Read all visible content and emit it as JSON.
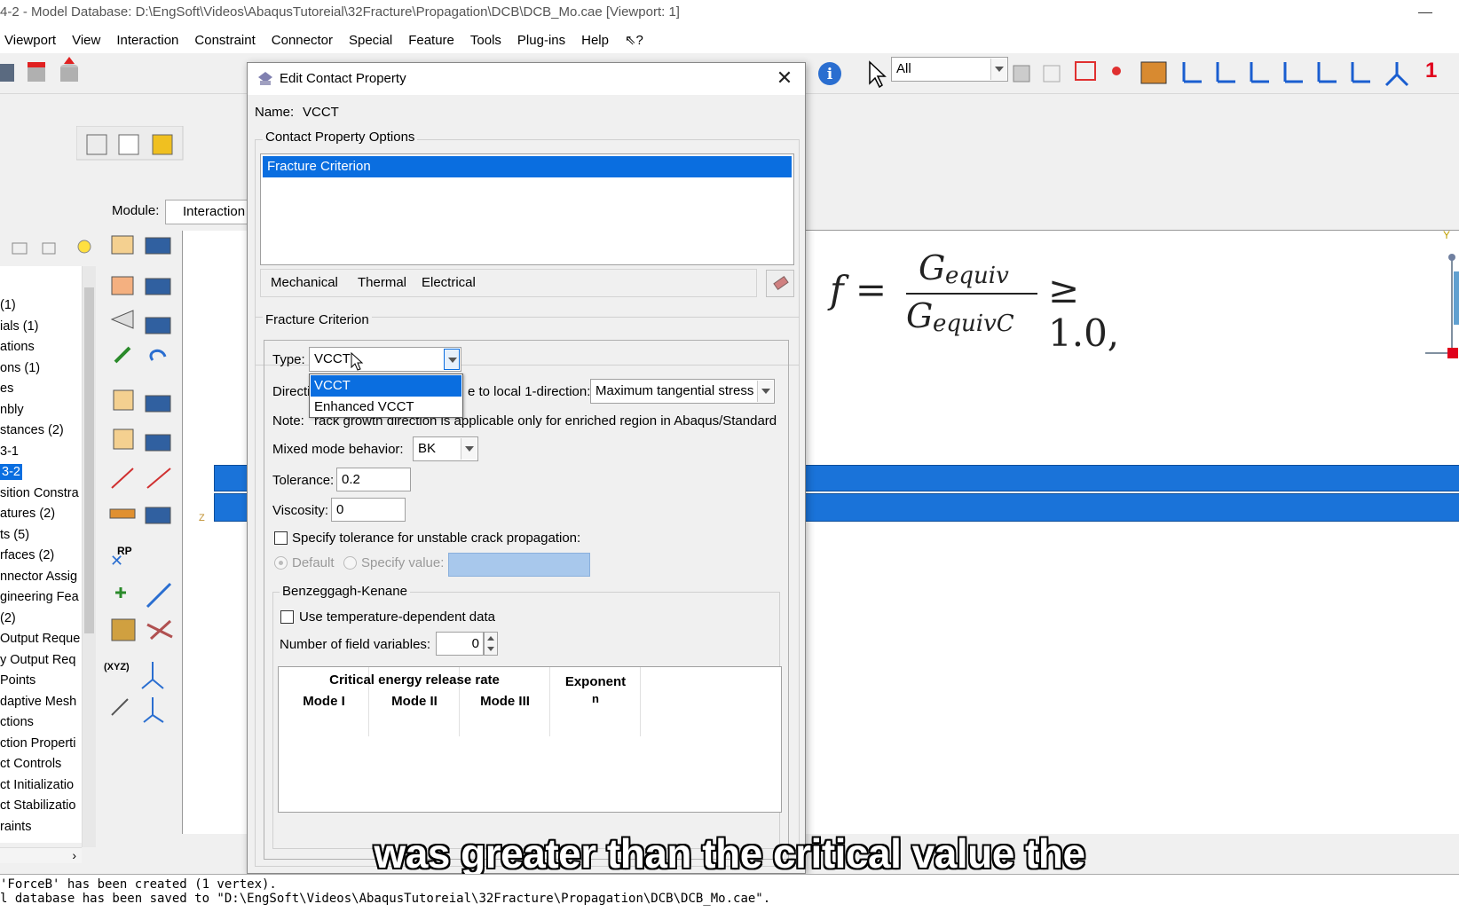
{
  "window": {
    "title": "4-2 - Model Database: D:\\EngSoft\\Videos\\AbaqusTutoreial\\32Fracture\\Propagation\\DCB\\DCB_Mo.cae [Viewport: 1]"
  },
  "menubar": {
    "items": [
      "Viewport",
      "View",
      "Interaction",
      "Constraint",
      "Connector",
      "Special",
      "Feature",
      "Tools",
      "Plug-ins",
      "Help",
      "⇖?"
    ]
  },
  "toolbar": {
    "selection_filter": "All",
    "triad_number": "1"
  },
  "module": {
    "label": "Module:",
    "value": "Interaction"
  },
  "tree": {
    "items": [
      "(1)",
      "ials (1)",
      "ations",
      "ons (1)",
      "es",
      "nbly",
      "stances (2)",
      "3-1",
      "3-2",
      "sition Constra",
      "atures (2)",
      "ts (5)",
      "rfaces (2)",
      "nnector Assig",
      "gineering Fea",
      " (2)",
      "Output Reque",
      "y Output Req",
      "Points",
      "daptive Mesh",
      "ctions",
      "ction Properti",
      "ct Controls",
      "ct Initializatio",
      "ct Stabilizatio",
      "raints"
    ],
    "selected_index": 8
  },
  "palette": {
    "rp_label": "RP",
    "xyz_label": "(XYZ)"
  },
  "formula": {
    "lhs": "f =",
    "numerator": "G",
    "numerator_sub": "equiv",
    "denominator": "G",
    "denominator_sub": "equivC",
    "rhs": "≥ 1.0,"
  },
  "canvas": {
    "axis_y": "Y",
    "axis_z": "Z"
  },
  "dialog": {
    "title": "Edit Contact Property",
    "name_label": "Name:",
    "name_value": "VCCT",
    "options_title": "Contact Property Options",
    "options_selected": "Fracture Criterion",
    "tabs": [
      "Mechanical",
      "Thermal",
      "Electrical"
    ],
    "section_title": "Fracture Criterion",
    "type_label": "Type:",
    "type_value": "VCCT",
    "type_options": [
      "VCCT",
      "Enhanced VCCT"
    ],
    "direction_label_start": "Directi",
    "direction_label_end": "e to local 1-direction:",
    "direction_value": "Maximum tangential stress",
    "note_start": "Note: ",
    "note_end": "rack growth direction is applicable only for enriched region in Abaqus/Standard",
    "mixed_mode_label": "Mixed mode behavior:",
    "mixed_mode_value": "BK",
    "tolerance_label": "Tolerance:",
    "tolerance_value": "0.2",
    "viscosity_label": "Viscosity:",
    "viscosity_value": "0",
    "unstable_check_label": "Specify tolerance for unstable crack propagation:",
    "radio_default": "Default",
    "radio_specify": "Specify value:",
    "bk_group_title": "Benzeggagh-Kenane",
    "temp_check_label": "Use temperature-dependent data",
    "field_vars_label": "Number of field variables:",
    "field_vars_value": "0",
    "table_group_header": "Critical energy release rate",
    "table_cols": [
      "Mode I",
      "Mode II",
      "Mode III"
    ],
    "exponent_header": "Exponent",
    "exponent_sub": "n"
  },
  "messages": {
    "line1": "'ForceB' has been created (1 vertex).",
    "line2": "l database has been saved to \"D:\\EngSoft\\Videos\\AbaqusTutoreial\\32Fracture\\Propagation\\DCB\\DCB_Mo.cae\"."
  },
  "subtitle": {
    "text": "was greater than the critical value the"
  },
  "colors": {
    "selection_blue": "#0a6ee0",
    "beam_blue": "#1a73d9",
    "axis_red": "#e0001b"
  }
}
